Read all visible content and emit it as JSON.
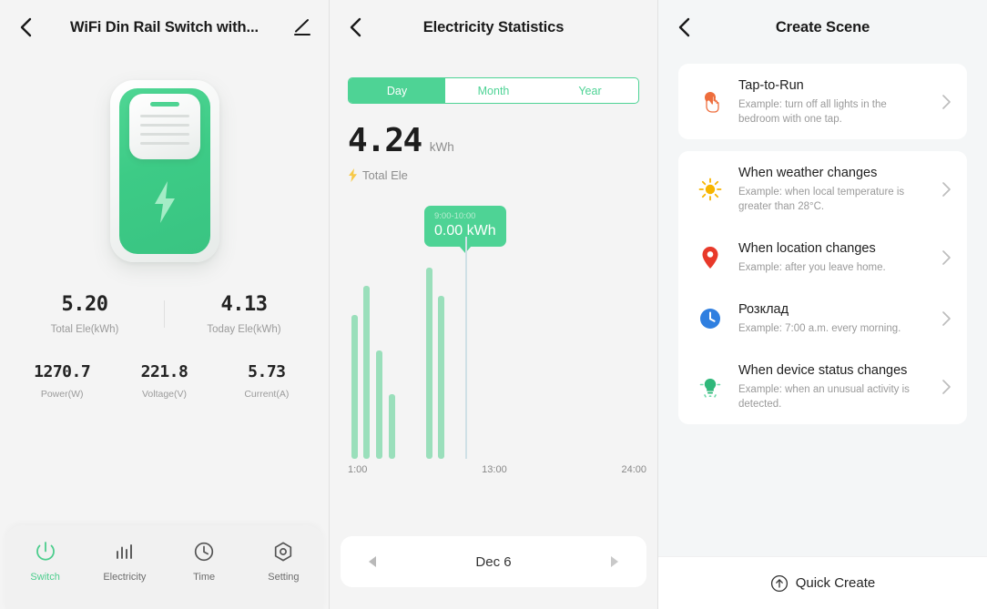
{
  "colors": {
    "green": "#4ed395",
    "bar": "#9adfbb",
    "cursor": "#cfe0e6",
    "orange": "#ee6d3c",
    "yellow": "#f7b500",
    "red": "#e8392a",
    "blue": "#2f7fe0",
    "panel_bg": "#f4f4f4"
  },
  "device_screen": {
    "navbar": {
      "title": "WiFi Din Rail Switch with...",
      "back_icon": "chevron-left-icon",
      "edit_icon": "pencil-edit-icon"
    },
    "device_icon": "din-rail-switch-icon",
    "stats_top": [
      {
        "value": "5.20",
        "label": "Total Ele(kWh)"
      },
      {
        "value": "4.13",
        "label": "Today Ele(kWh)"
      }
    ],
    "stats_bottom": [
      {
        "value": "1270.7",
        "label": "Power(W)"
      },
      {
        "value": "221.8",
        "label": "Voltage(V)"
      },
      {
        "value": "5.73",
        "label": "Current(A)"
      }
    ],
    "tabs": [
      {
        "label": "Switch",
        "icon": "power-icon",
        "active": true
      },
      {
        "label": "Electricity",
        "icon": "bar-chart-icon",
        "active": false
      },
      {
        "label": "Time",
        "icon": "clock-icon",
        "active": false
      },
      {
        "label": "Setting",
        "icon": "gear-hex-icon",
        "active": false
      }
    ]
  },
  "statistics_screen": {
    "navbar": {
      "title": "Electricity Statistics",
      "back_icon": "chevron-left-icon"
    },
    "segments": [
      {
        "label": "Day",
        "active": true
      },
      {
        "label": "Month",
        "active": false
      },
      {
        "label": "Year",
        "active": false
      }
    ],
    "summary": {
      "value": "4.24",
      "unit": "kWh",
      "caption": "Total Ele",
      "caption_icon": "lightning-bolt-icon"
    },
    "tooltip": {
      "time_range": "9:00-10:00",
      "value": "0.00 kWh"
    },
    "date_picker": {
      "label": "Dec 6",
      "prev_icon": "triangle-left-icon",
      "next_icon": "triangle-right-icon"
    },
    "chart_data": {
      "type": "bar",
      "title": "Electricity Statistics",
      "xlabel": "",
      "ylabel": "kWh",
      "xticks": [
        "1:00",
        "13:00",
        "24:00"
      ],
      "xlim": [
        0,
        24
      ],
      "ylim": [
        0,
        1.0
      ],
      "grid": false,
      "legend": null,
      "highlight": {
        "x": 9,
        "label": "9:00-10:00",
        "value": 0.0
      },
      "categories": [
        "1:00",
        "2:00",
        "3:00",
        "4:00",
        "5:00",
        "6:00",
        "7:00",
        "8:00",
        "9:00",
        "10:00",
        "11:00",
        "12:00",
        "13:00",
        "14:00",
        "15:00",
        "16:00",
        "17:00",
        "18:00",
        "19:00",
        "20:00",
        "21:00",
        "22:00",
        "23:00",
        "24:00"
      ],
      "values": [
        0.73,
        0.88,
        0.55,
        0.33,
        0,
        0,
        0.97,
        0.83,
        0,
        0,
        0,
        0,
        0,
        0,
        0,
        0,
        0,
        0,
        0,
        0,
        0,
        0,
        0,
        0
      ]
    }
  },
  "scene_screen": {
    "navbar": {
      "title": "Create Scene",
      "back_icon": "chevron-left-icon"
    },
    "featured": {
      "title": "Tap-to-Run",
      "subtitle": "Example: turn off all lights in the bedroom with one tap.",
      "icon": "tap-hand-icon",
      "chevron": "chevron-right-icon"
    },
    "conditions": [
      {
        "title": "When weather changes",
        "subtitle": "Example: when local temperature is greater than 28°C.",
        "icon": "sun-icon",
        "chevron": "chevron-right-icon"
      },
      {
        "title": "When location changes",
        "subtitle": "Example: after you leave home.",
        "icon": "location-pin-icon",
        "chevron": "chevron-right-icon"
      },
      {
        "title": "Розклад",
        "subtitle": "Example: 7:00 a.m. every morning.",
        "icon": "clock-icon",
        "chevron": "chevron-right-icon"
      },
      {
        "title": "When device status changes",
        "subtitle": "Example: when an unusual activity is detected.",
        "icon": "device-status-icon",
        "chevron": "chevron-right-icon"
      }
    ],
    "quick_create": {
      "label": "Quick Create",
      "icon": "circle-arrow-up-icon"
    }
  }
}
